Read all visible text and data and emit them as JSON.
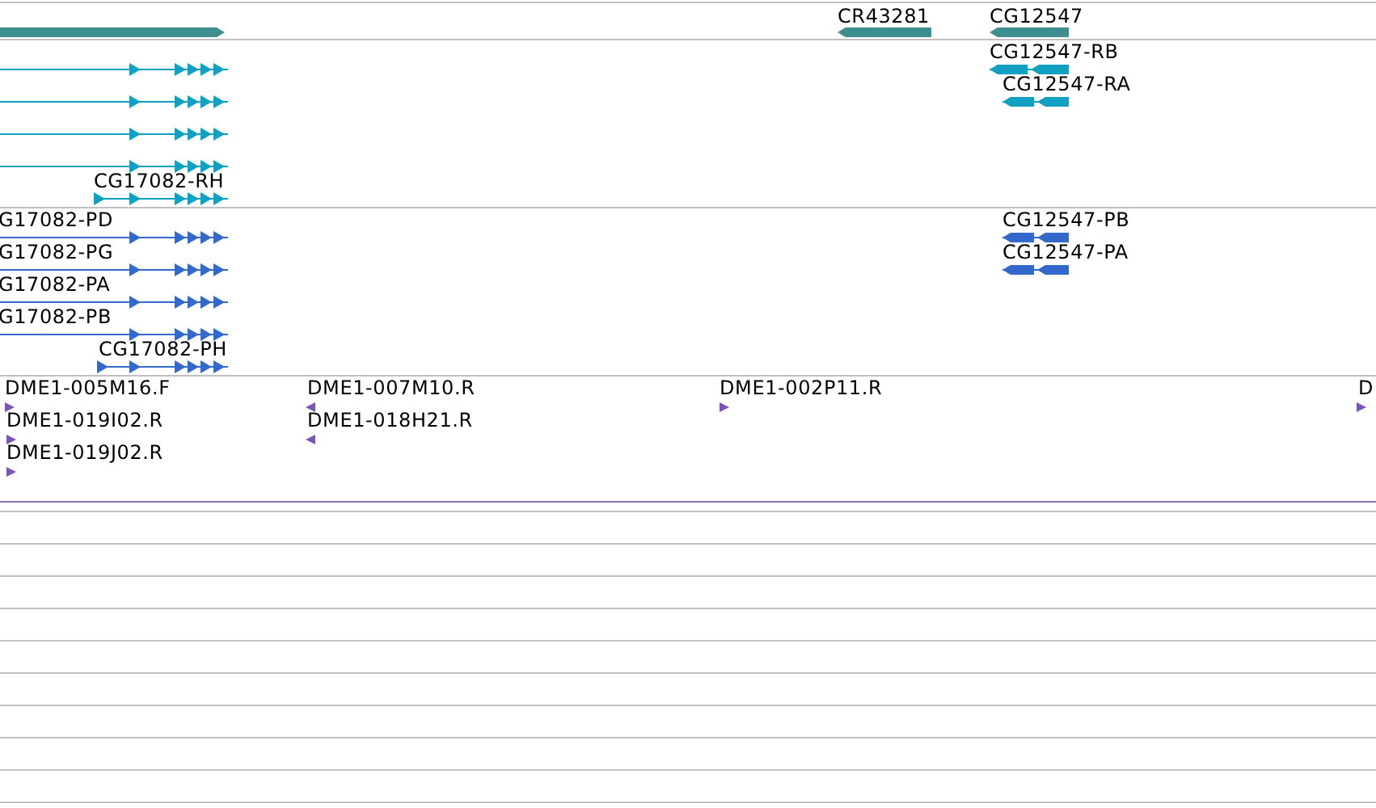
{
  "tracks": [
    {
      "kind": "gene",
      "features": [
        {
          "reverse": false
        },
        {
          "label": "CR43281",
          "reverse": true
        },
        {
          "label": "CG12547",
          "reverse": true
        }
      ]
    },
    {
      "kind": "transcript",
      "features": [
        {
          "reverse": false
        },
        {
          "reverse": false
        },
        {
          "reverse": false
        },
        {
          "reverse": false
        },
        {
          "label": "CG17082-RH",
          "reverse": false
        },
        {
          "label": "CG12547-RB",
          "reverse": true
        },
        {
          "label": "CG12547-RA",
          "reverse": true
        }
      ]
    },
    {
      "kind": "protein",
      "features": [
        {
          "label": "G17082-PD",
          "reverse": false
        },
        {
          "label": "G17082-PG",
          "reverse": false
        },
        {
          "label": "G17082-PA",
          "reverse": false
        },
        {
          "label": "G17082-PB",
          "reverse": false
        },
        {
          "label": "CG17082-PH",
          "reverse": false
        },
        {
          "label": "CG12547-PB",
          "reverse": true
        },
        {
          "label": "CG12547-PA",
          "reverse": true
        }
      ]
    },
    {
      "kind": "est",
      "features": [
        {
          "label": "DME1-005M16.F",
          "reverse": false
        },
        {
          "label": "DME1-019I02.R",
          "reverse": false
        },
        {
          "label": "DME1-019J02.R",
          "reverse": false
        },
        {
          "label": "DME1-007M10.R",
          "reverse": true
        },
        {
          "label": "DME1-018H21.R",
          "reverse": true
        },
        {
          "label": "DME1-002P11.R",
          "reverse": false
        },
        {
          "label": "D",
          "reverse": false
        }
      ]
    }
  ]
}
